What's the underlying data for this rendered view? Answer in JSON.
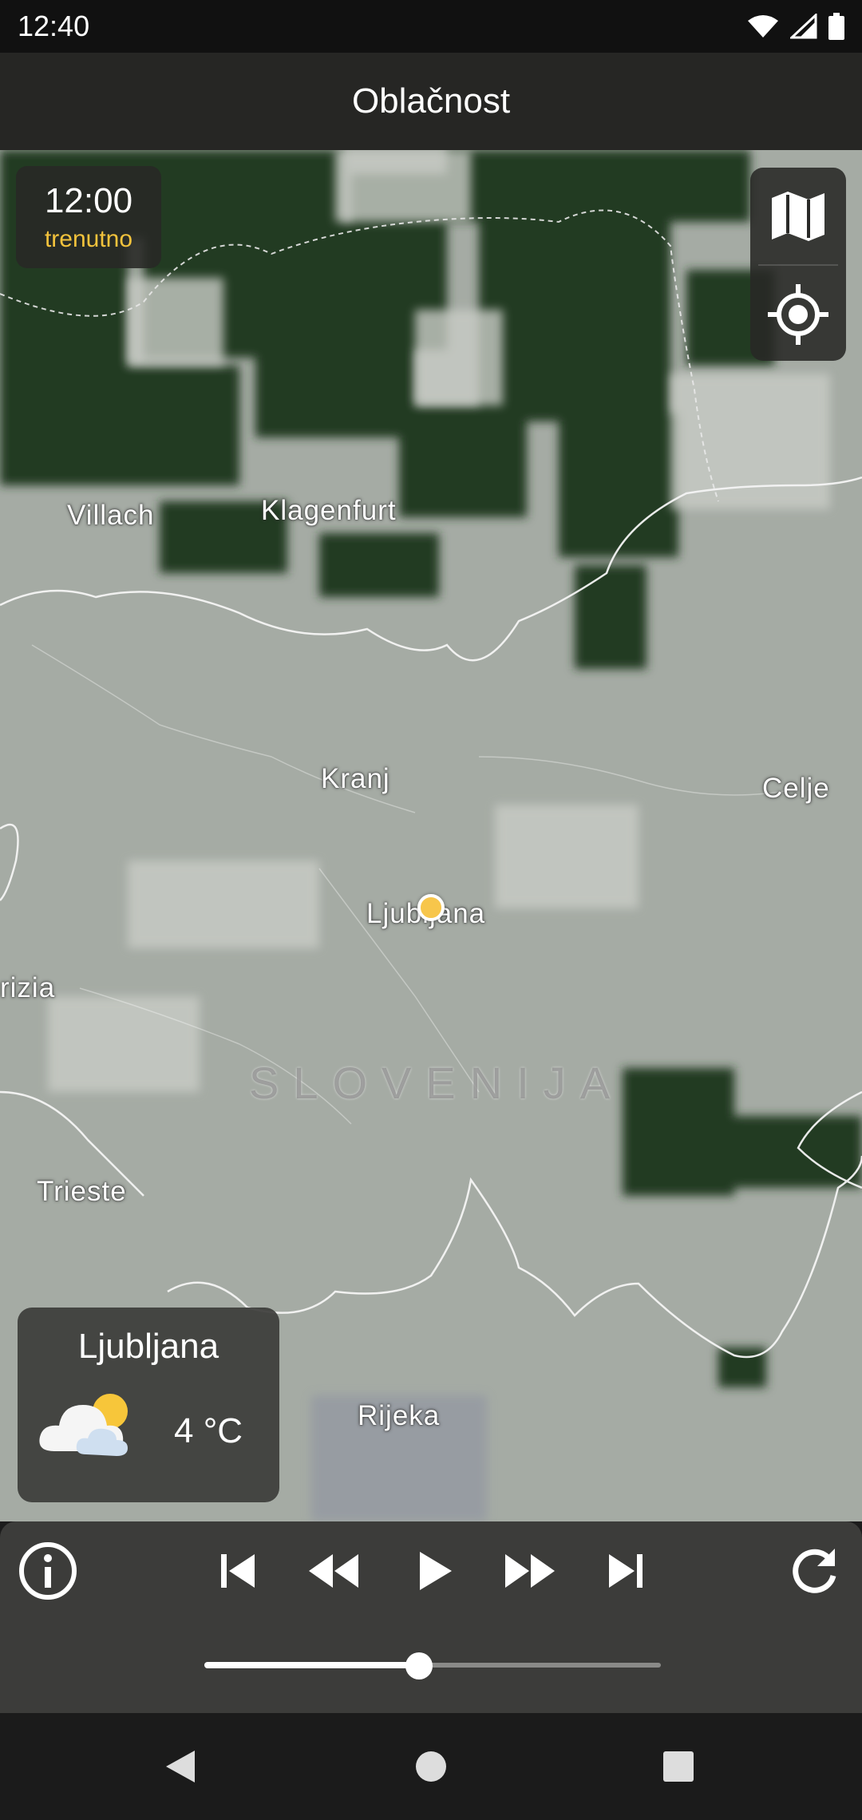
{
  "status_bar": {
    "time": "12:40",
    "icons": [
      "wifi-icon",
      "signal-icon",
      "battery-icon"
    ]
  },
  "app_bar": {
    "title": "Oblačnost"
  },
  "time_panel": {
    "time": "12:00",
    "label": "trenutno"
  },
  "map_controls": {
    "icons": [
      "map-layers-icon",
      "my-location-icon"
    ]
  },
  "map": {
    "cities": [
      {
        "id": "villach",
        "name": "Villach"
      },
      {
        "id": "klagenfurt",
        "name": "Klagenfurt"
      },
      {
        "id": "kranj",
        "name": "Kranj"
      },
      {
        "id": "celje",
        "name": "Celje"
      },
      {
        "id": "ljubljana",
        "name": "Ljubljana"
      },
      {
        "id": "gorizia",
        "name": "rizia"
      },
      {
        "id": "trieste",
        "name": "Trieste"
      },
      {
        "id": "rijeka",
        "name": "Rijeka"
      }
    ],
    "country_label": "SLOVENIJA",
    "marker_color": "#f7c64b"
  },
  "weather_card": {
    "city": "Ljubljana",
    "temperature": "4 °C",
    "icon": "partly-cloudy-icon"
  },
  "player": {
    "buttons": [
      "info-icon",
      "skip-to-start-icon",
      "rewind-icon",
      "play-icon",
      "fast-forward-icon",
      "skip-to-end-icon",
      "refresh-icon"
    ],
    "progress": 0.47
  },
  "nav_bar": {
    "buttons": [
      "back-icon",
      "home-icon",
      "recents-icon"
    ]
  },
  "colors": {
    "accent": "#f4c33c",
    "panel": "#282826",
    "player": "#3c3c3a"
  }
}
